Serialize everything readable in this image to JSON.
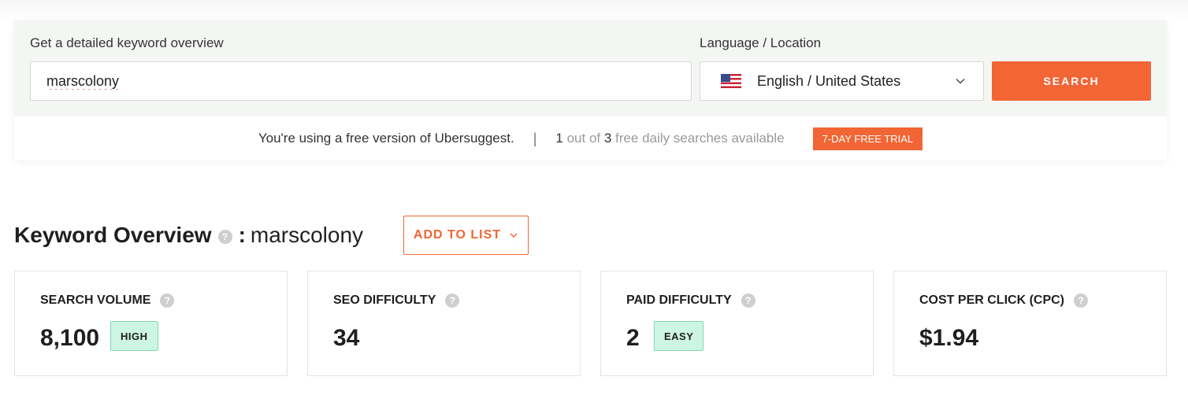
{
  "search": {
    "keyword_label": "Get a detailed keyword overview",
    "keyword_value": "marscolony",
    "language_label": "Language / Location",
    "language_value": "English / United States",
    "search_button": "SEARCH"
  },
  "free_bar": {
    "message": "You're using a free version of Ubersuggest.",
    "separator": "|",
    "used": "1",
    "out_of": " out of ",
    "total": "3",
    "suffix": " free daily searches available",
    "trial_button": "7-DAY FREE TRIAL"
  },
  "overview": {
    "heading": "Keyword Overview",
    "help_glyph": "?",
    "colon": ":",
    "keyword": "marscolony",
    "add_to_list": "ADD TO LIST"
  },
  "cards": [
    {
      "label": "SEARCH VOLUME",
      "value": "8,100",
      "badge": "HIGH"
    },
    {
      "label": "SEO DIFFICULTY",
      "value": "34"
    },
    {
      "label": "PAID DIFFICULTY",
      "value": "2",
      "badge": "EASY"
    },
    {
      "label": "COST PER CLICK (CPC)",
      "value": "$1.94"
    }
  ],
  "colors": {
    "accent": "#f26534",
    "badge_bg": "#cdf5e3",
    "badge_border": "#7fd8b0",
    "panel_bg": "#f4f6f4"
  }
}
